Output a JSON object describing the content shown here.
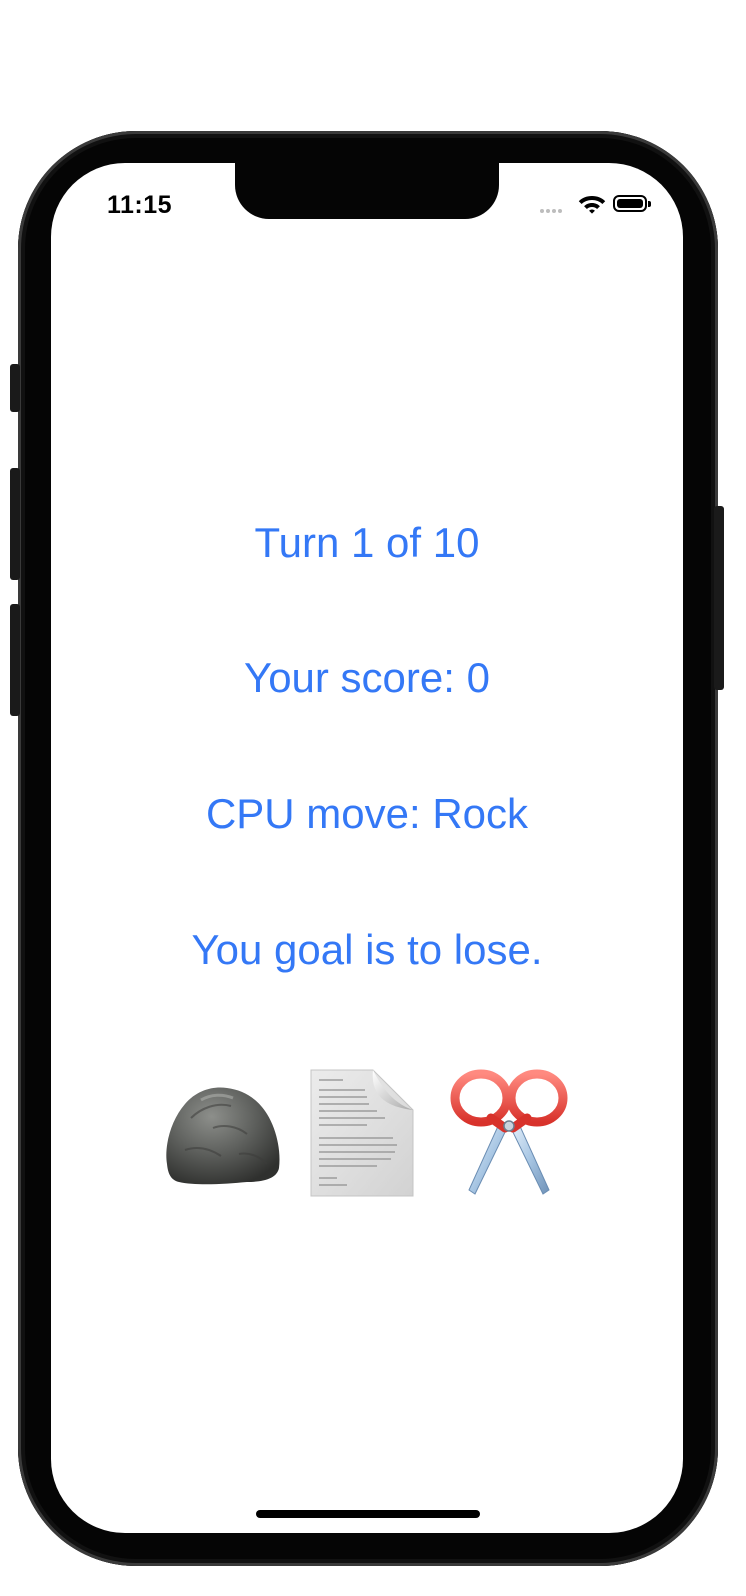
{
  "status_bar": {
    "time": "11:15",
    "icons": [
      "cellular-signal-icon",
      "wifi-icon",
      "battery-icon"
    ]
  },
  "game": {
    "turn_label": "Turn 1 of 10",
    "score_label": "Your score: 0",
    "cpu_move_label": "CPU move: Rock",
    "goal_label": "You goal is to lose."
  },
  "moves": [
    {
      "name": "Rock",
      "icon": "rock-emoji"
    },
    {
      "name": "Paper",
      "icon": "page-emoji"
    },
    {
      "name": "Scissors",
      "icon": "scissors-emoji"
    }
  ],
  "colors": {
    "accent": "#3478f6",
    "frame": "#050505",
    "background": "#ffffff"
  }
}
